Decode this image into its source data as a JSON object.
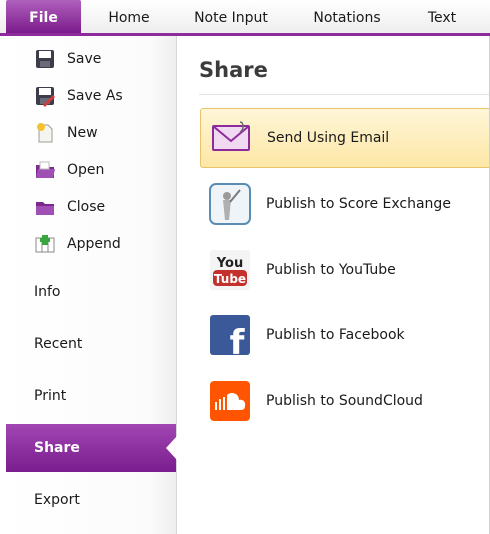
{
  "ribbon": {
    "tabs": [
      {
        "label": "File"
      },
      {
        "label": "Home"
      },
      {
        "label": "Note Input"
      },
      {
        "label": "Notations"
      },
      {
        "label": "Text"
      }
    ]
  },
  "sidebar": {
    "commands": [
      {
        "label": "Save",
        "icon": "save-icon"
      },
      {
        "label": "Save As",
        "icon": "save-as-icon"
      },
      {
        "label": "New",
        "icon": "new-document-icon"
      },
      {
        "label": "Open",
        "icon": "open-folder-icon"
      },
      {
        "label": "Close",
        "icon": "close-folder-icon"
      },
      {
        "label": "Append",
        "icon": "append-icon"
      }
    ],
    "sections": [
      {
        "label": "Info"
      },
      {
        "label": "Recent"
      },
      {
        "label": "Print"
      },
      {
        "label": "Share",
        "active": true
      },
      {
        "label": "Export"
      }
    ]
  },
  "main": {
    "title": "Share",
    "items": [
      {
        "label": "Send Using Email",
        "icon": "email-icon",
        "selected": true
      },
      {
        "label": "Publish to Score Exchange",
        "icon": "score-exchange-icon"
      },
      {
        "label": "Publish to YouTube",
        "icon": "youtube-icon",
        "icon_text_top": "You",
        "icon_text_bottom": "Tube"
      },
      {
        "label": "Publish to Facebook",
        "icon": "facebook-icon",
        "icon_text": "f"
      },
      {
        "label": "Publish to SoundCloud",
        "icon": "soundcloud-icon"
      }
    ]
  },
  "colors": {
    "accent": "#8e2b9c",
    "selected_bg": "#fde7a6",
    "youtube_red": "#c4302b",
    "facebook_blue": "#3b5998",
    "soundcloud_orange": "#ff5500"
  }
}
